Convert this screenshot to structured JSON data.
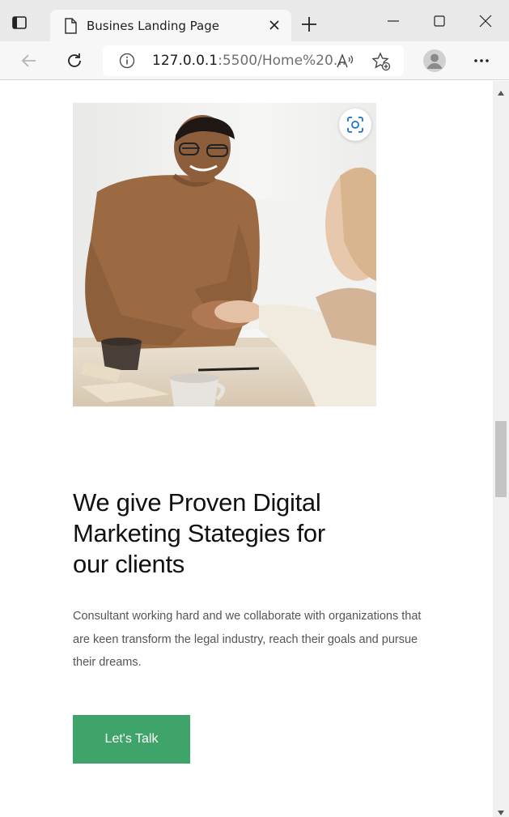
{
  "browser": {
    "tab_title": "Busines Landing Page",
    "url_host": "127.0.0.1",
    "url_rest": ":5500/Home%20...",
    "icons": {
      "tab_actions": "tab-actions-icon",
      "favicon": "page-icon",
      "tab_close": "close-icon",
      "new_tab": "plus-icon",
      "minimize": "minimize-icon",
      "maximize": "maximize-icon",
      "close_window": "close-icon",
      "back": "back-arrow-icon",
      "refresh": "refresh-icon",
      "site_info": "info-icon",
      "read_aloud": "read-aloud-icon",
      "favorites": "add-favorite-icon",
      "profile": "profile-avatar-icon",
      "menu": "more-dots-icon"
    }
  },
  "page": {
    "hero_image_alt": "handshake-photo",
    "visual_search_icon": "visual-search-icon",
    "headline": "We give Proven Digital Marketing Stategies for our clients",
    "body": "Consultant working hard and we collaborate with organizations that are keen transform the legal industry, reach their goals and pursue their dreams.",
    "cta_label": "Let's Talk"
  },
  "colors": {
    "cta_background": "#3fa46a",
    "headline": "#111111",
    "body_text": "#555555"
  }
}
